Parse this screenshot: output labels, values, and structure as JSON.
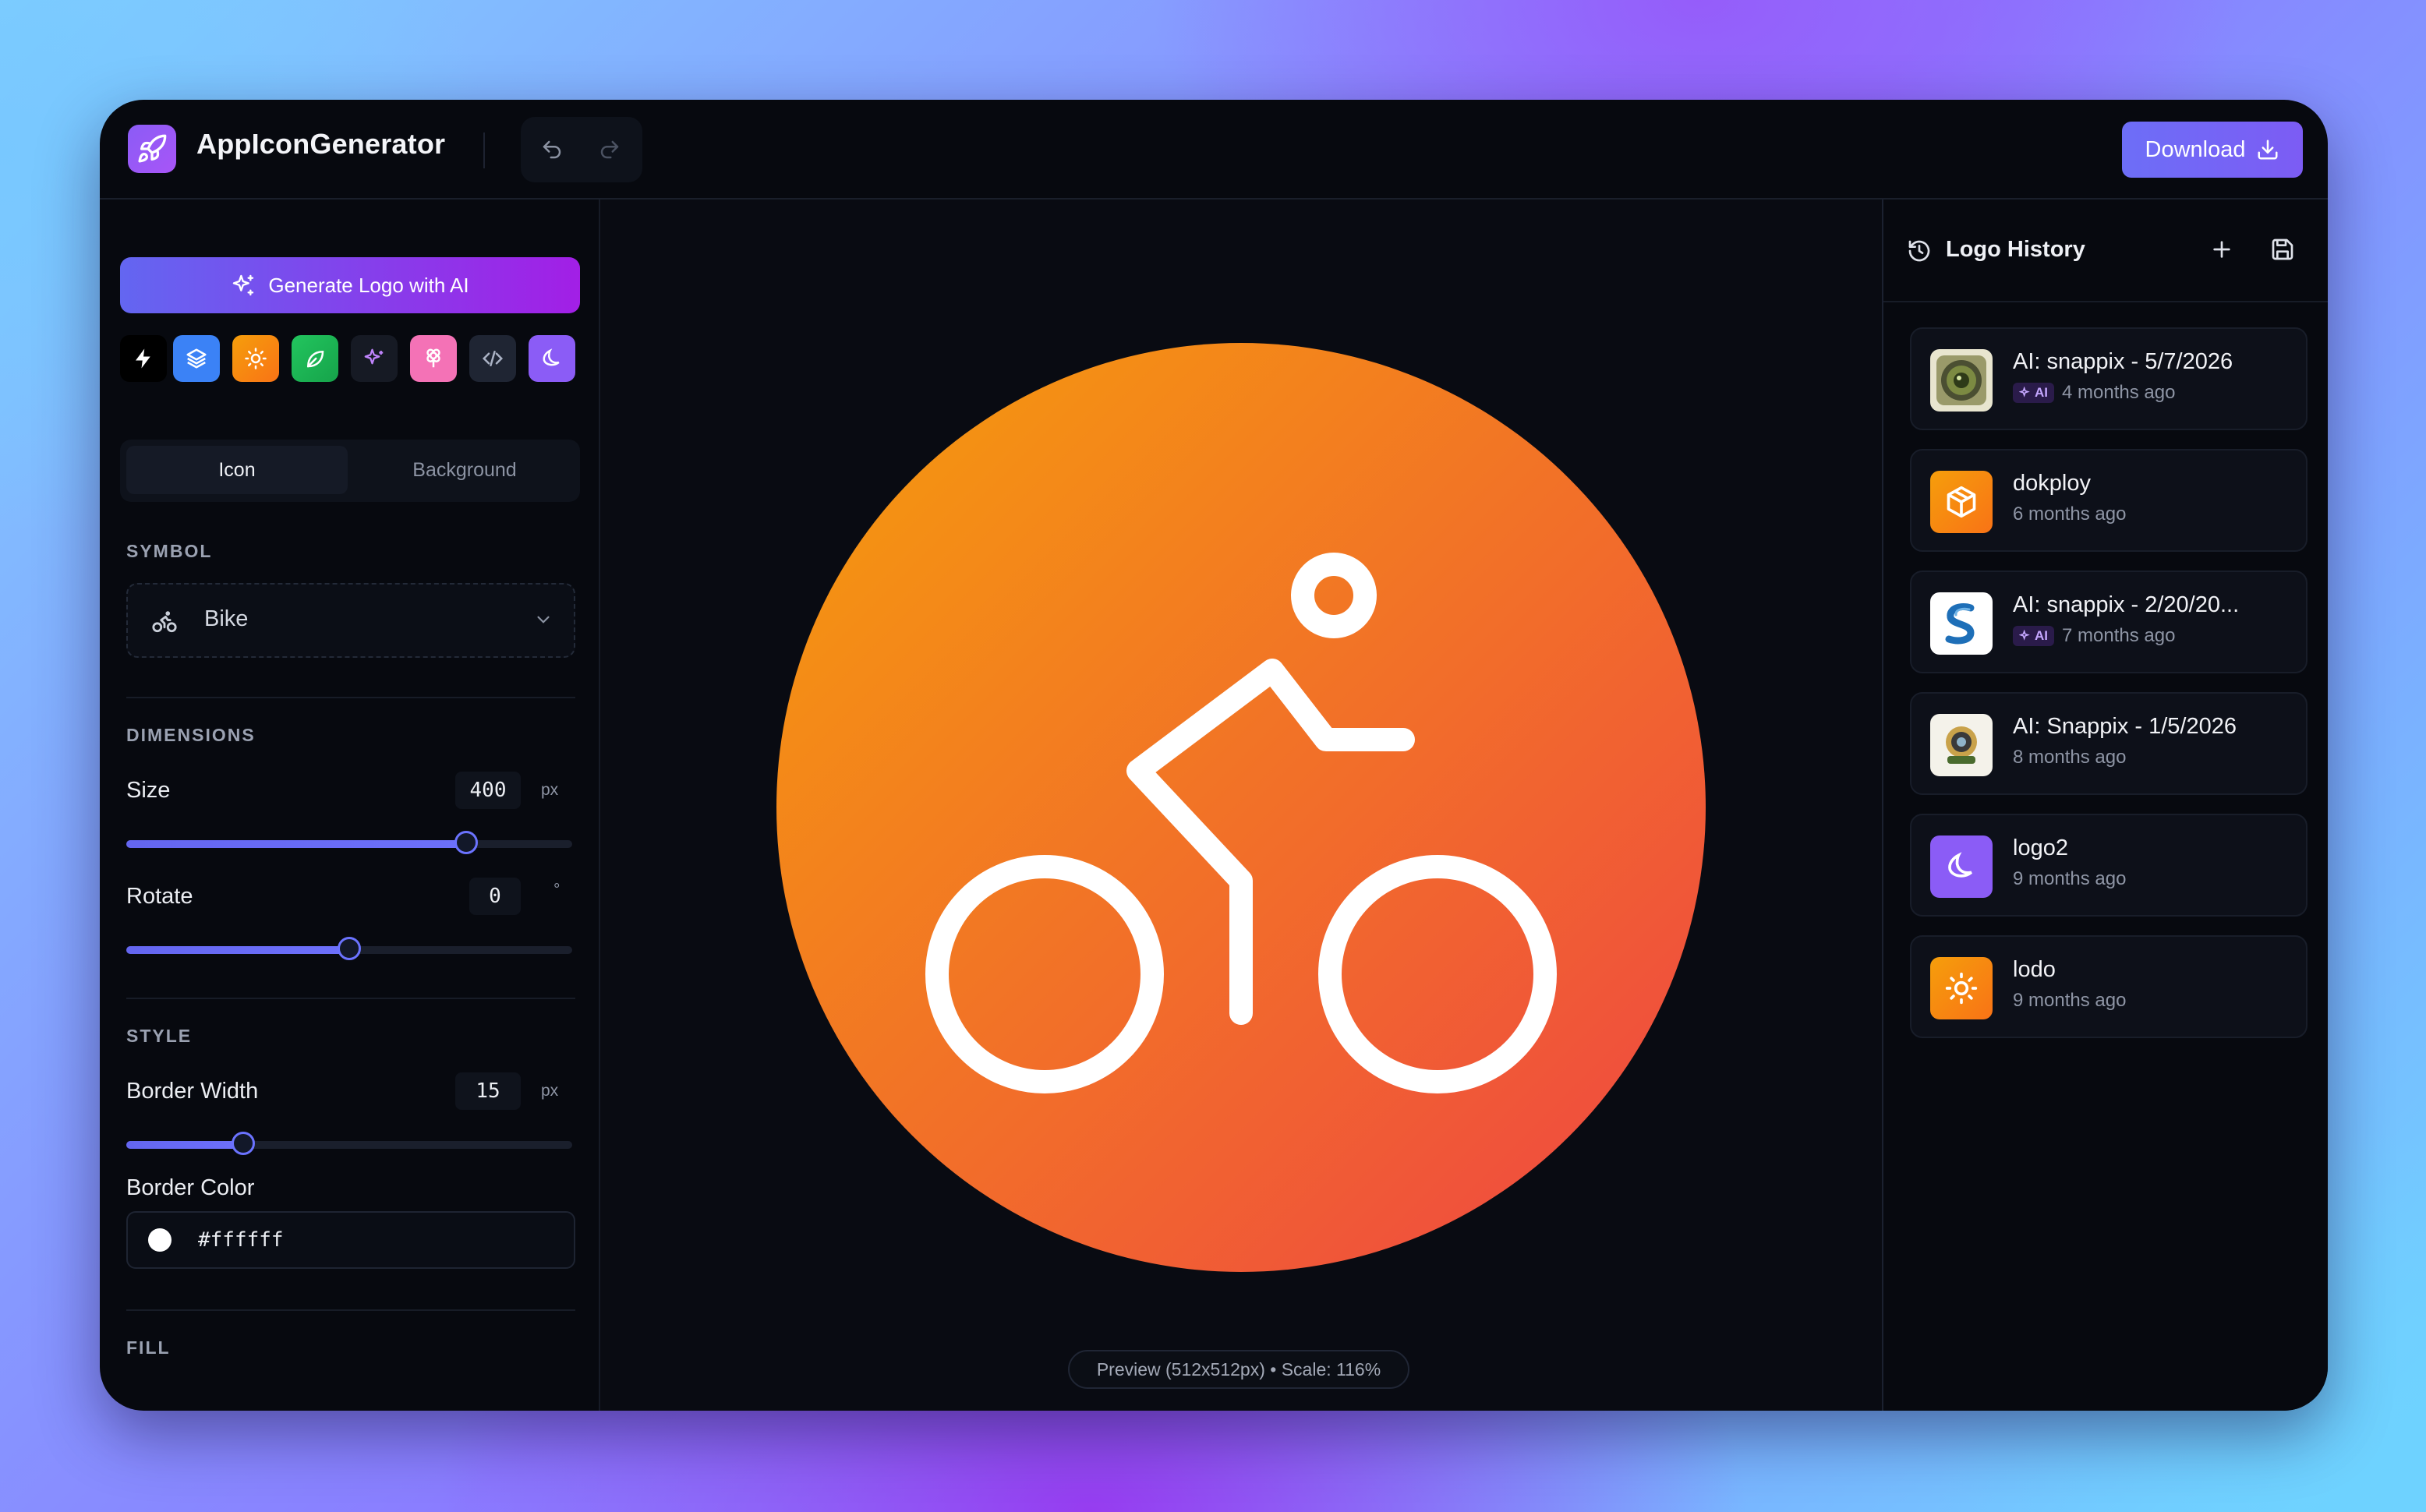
{
  "app": {
    "name": "AppIconGenerator"
  },
  "header": {
    "download_label": "Download"
  },
  "left_panel": {
    "generate_label": "Generate Logo with AI",
    "presets": [
      {
        "icon": "bolt-icon",
        "bg": "#000000"
      },
      {
        "icon": "layers-icon",
        "bg": "#3b82f6"
      },
      {
        "icon": "sun-icon",
        "bg": "#f97316"
      },
      {
        "icon": "leaf-icon",
        "bg": "#22c55e"
      },
      {
        "icon": "sparkles-icon",
        "bg": "#111827"
      },
      {
        "icon": "flower-icon",
        "bg": "#f472b6"
      },
      {
        "icon": "code-icon",
        "bg": "#1f2937"
      },
      {
        "icon": "banana-icon",
        "bg": "#8b5cf6"
      }
    ],
    "tabs": {
      "icon": "Icon",
      "background": "Background"
    },
    "symbol": {
      "section": "SYMBOL",
      "value": "Bike",
      "icon": "bike-icon"
    },
    "dimensions": {
      "section": "DIMENSIONS",
      "size_label": "Size",
      "size_value": "400",
      "size_unit": "px",
      "size_fraction": 0.76,
      "rotate_label": "Rotate",
      "rotate_value": "0",
      "rotate_unit": "°",
      "rotate_fraction": 0.5
    },
    "style": {
      "section": "STYLE",
      "border_width_label": "Border Width",
      "border_width_value": "15",
      "border_width_unit": "px",
      "border_width_fraction": 0.26,
      "border_color_label": "Border Color",
      "border_color_value": "#ffffff"
    },
    "fill": {
      "section": "FILL"
    }
  },
  "preview": {
    "caption": "Preview (512x512px) • Scale: 116%",
    "gradient_start": "#f59e0b",
    "gradient_end": "#ef4444",
    "stroke": "#ffffff"
  },
  "history": {
    "title": "Logo History",
    "items": [
      {
        "name": "AI: snappix - 5/7/2026",
        "time": "4 months ago",
        "ai": true,
        "ai_label": "AI"
      },
      {
        "name": "dokploy",
        "time": "6 months ago",
        "ai": false
      },
      {
        "name": "AI: snappix - 2/20/20...",
        "time": "7 months ago",
        "ai": true,
        "ai_label": "AI"
      },
      {
        "name": "AI: Snappix - 1/5/2026",
        "time": "8 months ago",
        "ai": false
      },
      {
        "name": "logo2",
        "time": "9 months ago",
        "ai": false
      },
      {
        "name": "lodo",
        "time": "9 months ago",
        "ai": false
      }
    ]
  }
}
